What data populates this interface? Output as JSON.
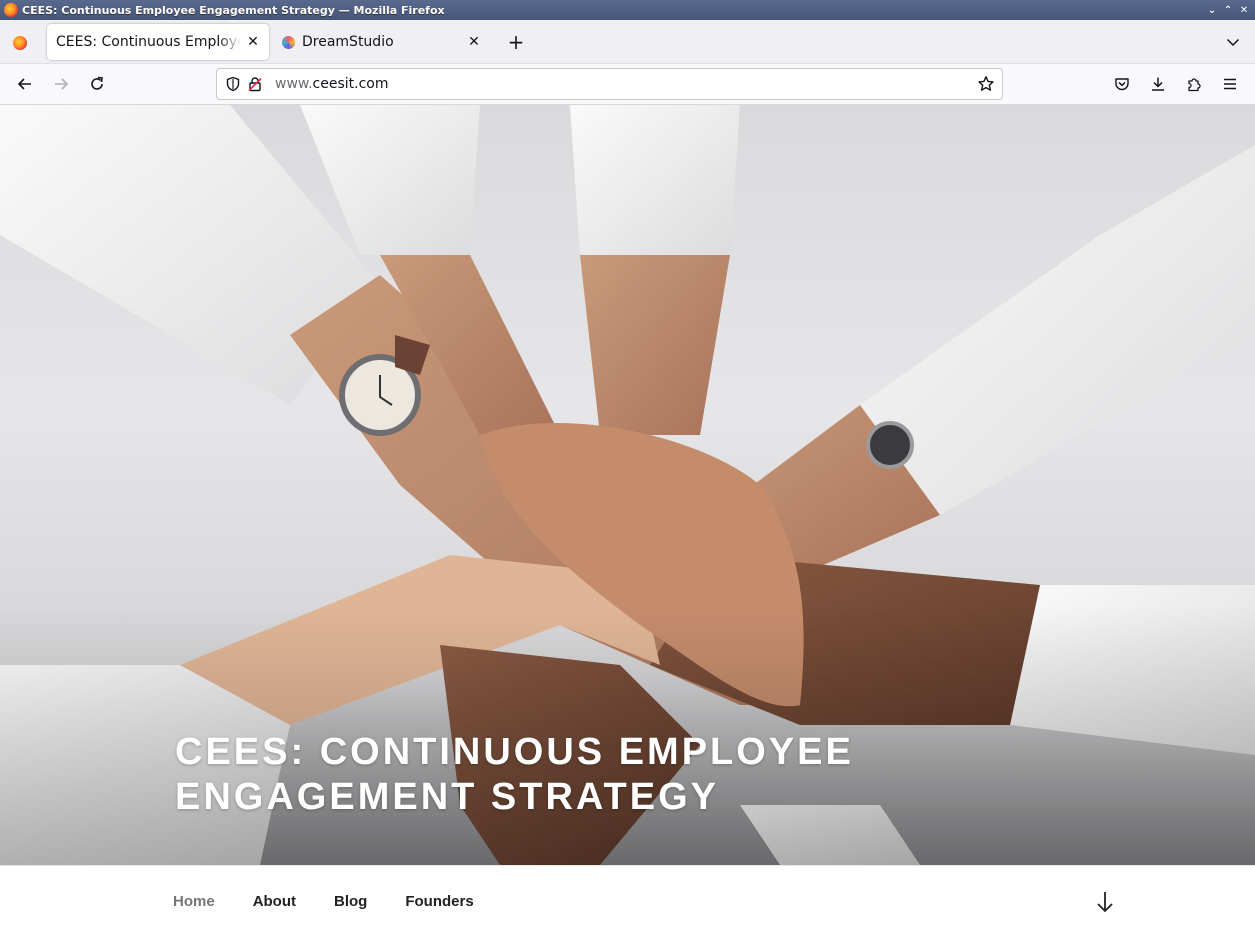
{
  "window": {
    "title": "CEES: Continuous Employee Engagement Strategy — Mozilla Firefox"
  },
  "tabs": [
    {
      "title": "CEES: Continuous Employee Engagement Strategy",
      "active": true,
      "icon": "firefox-icon"
    },
    {
      "title": "DreamStudio",
      "active": false,
      "icon": "dreamstudio-icon"
    }
  ],
  "urlbar": {
    "prefix": "www.",
    "domain": "ceesit.com"
  },
  "hero": {
    "title": "CEES: Continuous Employee Engagement Strategy"
  },
  "site_nav": {
    "items": [
      {
        "label": "Home",
        "current": true
      },
      {
        "label": "About",
        "current": false
      },
      {
        "label": "Blog",
        "current": false
      },
      {
        "label": "Founders",
        "current": false
      }
    ]
  },
  "colors": {
    "titlebar": "#4f5f85",
    "tabstrip": "#f0f0f4",
    "nav_text": "#222222",
    "nav_current": "#767676"
  }
}
